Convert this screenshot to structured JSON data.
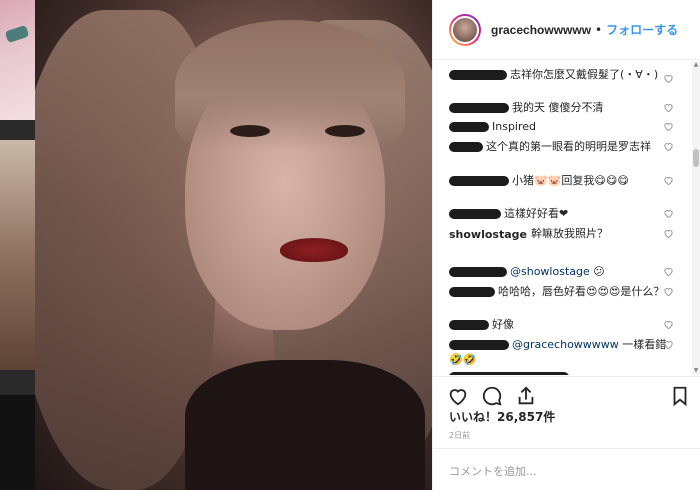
{
  "header": {
    "username": "gracechowwwww",
    "separator": "•",
    "follow_label": "フォローする"
  },
  "comments": [
    {
      "user": "",
      "text": "志祥你怎麼又戴假髮了(・∀・)"
    },
    {
      "user": "",
      "text": "我的天 傻傻分不清"
    },
    {
      "user": "",
      "text": "Inspired"
    },
    {
      "user": "",
      "text": "这个真的第一眼看的明明是罗志祥"
    },
    {
      "user": "",
      "text": "小猪🐷🐷回复我😋😋😋"
    },
    {
      "user": "",
      "text": "這樣好好看❤"
    },
    {
      "user": "showlostage",
      "text": "幹嘛放我照片？"
    },
    {
      "user": "",
      "mention": "@showlostage",
      "text": "😕"
    },
    {
      "user": "",
      "text": "哈哈哈，唇色好看😍😍😍是什么？"
    },
    {
      "user": "",
      "text": "好像"
    },
    {
      "user": "",
      "mention": "@gracechowwwww",
      "text": "一樣看錯🤣🤣"
    }
  ],
  "likes": {
    "label": "いいね！26,857件"
  },
  "timestamp": "2日前",
  "add_comment": {
    "placeholder": "コメントを追加..."
  },
  "icons": [
    "heart-icon",
    "comment-icon",
    "share-icon",
    "bookmark-icon"
  ],
  "colors": {
    "link": "#3897f0",
    "text": "#262626",
    "muted": "#999999"
  }
}
